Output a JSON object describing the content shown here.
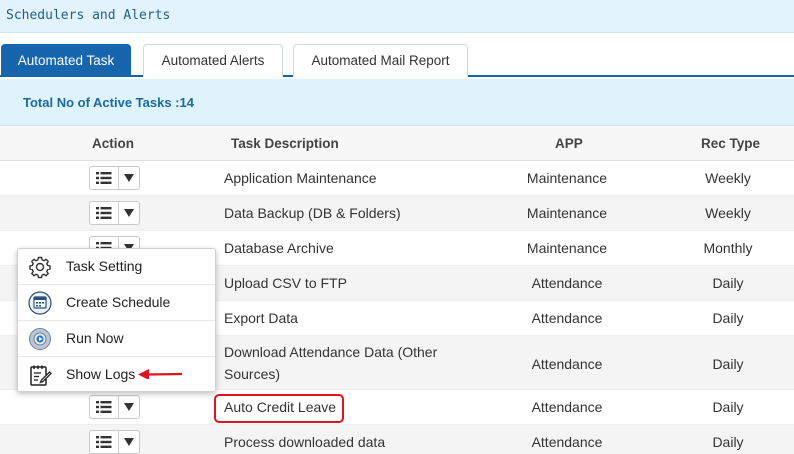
{
  "window": {
    "title": "Schedulers and Alerts"
  },
  "tabs": [
    {
      "label": "Automated Task",
      "active": true
    },
    {
      "label": "Automated Alerts",
      "active": false
    },
    {
      "label": "Automated Mail Report",
      "active": false
    }
  ],
  "summary": {
    "text": "Total No of Active Tasks :14"
  },
  "table": {
    "headers": {
      "action": "Action",
      "description": "Task Description",
      "app": "APP",
      "rec_type": "Rec Type"
    },
    "rows": [
      {
        "description": "Application Maintenance",
        "app": "Maintenance",
        "rec_type": "Weekly"
      },
      {
        "description": "Data Backup (DB & Folders)",
        "app": "Maintenance",
        "rec_type": "Weekly"
      },
      {
        "description": "Database Archive",
        "app": "Maintenance",
        "rec_type": "Monthly"
      },
      {
        "description": "Upload CSV to FTP",
        "app": "Attendance",
        "rec_type": "Daily"
      },
      {
        "description": "Export Data",
        "app": "Attendance",
        "rec_type": "Daily"
      },
      {
        "description": "Download Attendance Data (Other Sources)",
        "app": "Attendance",
        "rec_type": "Daily"
      },
      {
        "description": "Auto Credit Leave",
        "app": "Attendance",
        "rec_type": "Daily"
      },
      {
        "description": "Process downloaded data",
        "app": "Attendance",
        "rec_type": "Daily"
      }
    ]
  },
  "action_menu": {
    "items": [
      {
        "label": "Task Setting",
        "icon": "gear-icon"
      },
      {
        "label": "Create Schedule",
        "icon": "calendar-clock-icon"
      },
      {
        "label": "Run Now",
        "icon": "run-gear-icon"
      },
      {
        "label": "Show Logs",
        "icon": "logs-notepad-icon"
      }
    ]
  },
  "colors": {
    "accent": "#1665ad",
    "highlight": "#e0141e",
    "info_bg": "#dff3fc"
  }
}
